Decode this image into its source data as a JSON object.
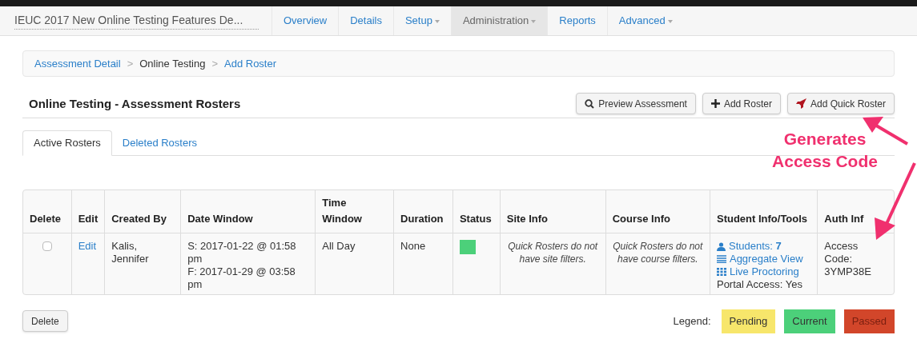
{
  "nav": {
    "title": "IEUC 2017 New Online Testing Features De...",
    "items": [
      {
        "label": "Overview",
        "dropdown": false,
        "selected": false
      },
      {
        "label": "Details",
        "dropdown": false,
        "selected": false
      },
      {
        "label": "Setup",
        "dropdown": true,
        "selected": false
      },
      {
        "label": "Administration",
        "dropdown": true,
        "selected": true
      },
      {
        "label": "Reports",
        "dropdown": false,
        "selected": false
      },
      {
        "label": "Advanced",
        "dropdown": true,
        "selected": false
      }
    ]
  },
  "breadcrumb": [
    {
      "label": "Assessment Detail",
      "link": true
    },
    {
      "separator": ">",
      "label": "Online Testing",
      "link": false
    },
    {
      "separator": ">",
      "label": "Add Roster",
      "link": true
    }
  ],
  "page_title": "Online Testing - Assessment Rosters",
  "actions": [
    {
      "label": "Preview Assessment",
      "kind": "search"
    },
    {
      "label": "Add Roster",
      "kind": "plus"
    },
    {
      "label": "Add Quick Roster",
      "kind": "rocket"
    }
  ],
  "tabs": [
    {
      "label": "Active Rosters",
      "selected": true
    },
    {
      "label": "Deleted Rosters",
      "selected": false
    }
  ],
  "table": {
    "columns": [
      "Delete",
      "Edit",
      "Created By",
      "Date Window",
      "Time Window",
      "Duration",
      "Status",
      "Site Info",
      "Course Info",
      "Student Info/Tools",
      "Auth Inf"
    ],
    "rows": [
      {
        "checked": false,
        "edit": "Edit",
        "created_by": "Kalis, Jennifer",
        "date_window": [
          "S: 2017-01-22 @ 01:58 pm",
          "F: 2017-01-29 @ 03:58 pm"
        ],
        "time_window": "All Day",
        "duration": "None",
        "status": {
          "color": "#4cd07a"
        },
        "site_info": "Quick Rosters do not have site filters.",
        "course_info": "Quick Rosters do not have course filters.",
        "tools": [
          {
            "kind": "user",
            "label": "Students: **7**"
          },
          {
            "kind": "list",
            "label": "Aggregate View"
          },
          {
            "kind": "grid",
            "label": "Live Proctoring"
          }
        ],
        "portal_access": "Portal Access: Yes",
        "auth_info": "Access Code: 3YMP38E"
      }
    ]
  },
  "delete_button": "Delete",
  "legend": {
    "label": "Legend:",
    "items": [
      {
        "label": "Pending",
        "color": "#f7e66b"
      },
      {
        "label": "Current",
        "color": "#4cd07a"
      },
      {
        "label": "Passed",
        "color": "#d2462a"
      }
    ]
  },
  "annotation": "Generates Access Code"
}
